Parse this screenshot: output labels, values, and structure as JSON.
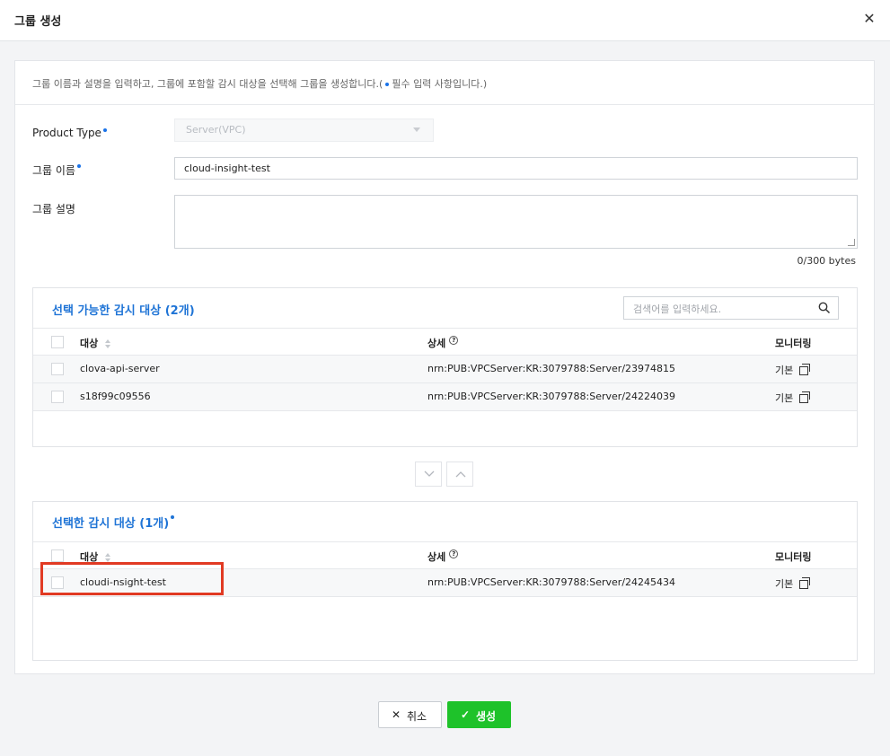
{
  "dialog": {
    "title": "그룹 생성",
    "close_icon": "close-icon"
  },
  "form": {
    "description": "그룹 이름과 설명을 입력하고, 그룹에 포함할 감시 대상을 선택해 그룹을 생성합니다.(",
    "description_tail": "필수 입력 사항입니다.)",
    "product_type_label": "Product Type",
    "product_type_value": "Server(VPC)",
    "group_name_label": "그룹 이름",
    "group_name_value": "cloud-insight-test",
    "group_desc_label": "그룹 설명",
    "byte_count": "0/300 bytes"
  },
  "available": {
    "title": "선택 가능한 감시 대상 (2개)",
    "search_placeholder": "검색어를 입력하세요.",
    "columns": {
      "name": "대상",
      "detail": "상세",
      "monitoring": "모니터링"
    },
    "rows": [
      {
        "name": "clova-api-server",
        "detail": "nrn:PUB:VPCServer:KR:3079788:Server/23974815",
        "monitoring": "기본"
      },
      {
        "name": "s18f99c09556",
        "detail": "nrn:PUB:VPCServer:KR:3079788:Server/24224039",
        "monitoring": "기본"
      }
    ]
  },
  "selected": {
    "title": "선택한 감시 대상 (1개)",
    "columns": {
      "name": "대상",
      "detail": "상세",
      "monitoring": "모니터링"
    },
    "rows": [
      {
        "name": "cloudi-nsight-test",
        "detail": "nrn:PUB:VPCServer:KR:3079788:Server/24245434",
        "monitoring": "기본"
      }
    ]
  },
  "footer": {
    "cancel_label": "취소",
    "create_label": "생성"
  },
  "colors": {
    "accent_blue": "#1f74d6",
    "create_green": "#1ec22a",
    "highlight_red": "#e13a23"
  }
}
